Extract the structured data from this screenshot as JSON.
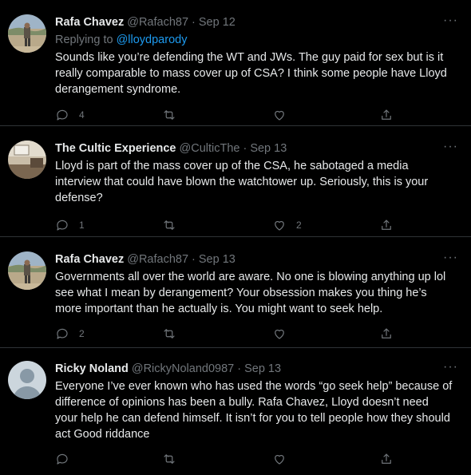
{
  "thread": {
    "tweets": [
      {
        "name": "Rafa Chavez",
        "handle": "@Rafach87",
        "separator": "·",
        "date": "Sep 12",
        "reply_label": "Replying to",
        "reply_mention": "@lloydparody",
        "text": "Sounds like you’re defending the WT and JWs. The guy paid for sex but is it really comparable to mass cover up of CSA? I think some people have Lloyd derangement syndrome.",
        "reply_count": "4",
        "retweet_count": "",
        "like_count": "",
        "more": "···",
        "avatar": "landscape-photo"
      },
      {
        "name": "The Cultic Experience",
        "handle": "@CulticThe",
        "separator": "·",
        "date": "Sep 13",
        "text": "Lloyd is part of the mass cover up of the CSA, he sabotaged a media interview that could have blown the watchtower up. Seriously, this is your defense?",
        "reply_count": "1",
        "retweet_count": "",
        "like_count": "2",
        "more": "···",
        "avatar": "room-photo"
      },
      {
        "name": "Rafa Chavez",
        "handle": "@Rafach87",
        "separator": "·",
        "date": "Sep 13",
        "text": "Governments all over the world are aware. No one is blowing anything up lol see what I mean by derangement? Your obsession makes you thing he’s more important than he actually is. You might want to seek help.",
        "reply_count": "2",
        "retweet_count": "",
        "like_count": "",
        "more": "···",
        "avatar": "landscape-photo"
      },
      {
        "name": "Ricky Noland",
        "handle": "@RickyNoland0987",
        "separator": "·",
        "date": "Sep 13",
        "text": "Everyone I’ve ever known who has used the words “go seek help” because of difference of opinions has been a bully. Rafa Chavez, Lloyd doesn’t need your help he can defend himself. It isn’t for you to tell people how they should act Good riddance",
        "reply_count": "",
        "retweet_count": "",
        "like_count": "",
        "more": "···",
        "avatar": "default-avatar"
      }
    ]
  },
  "colors": {
    "background": "#000000",
    "text": "#e7e9ea",
    "muted": "#71767b",
    "link": "#1d9bf0",
    "divider": "#2f3336"
  }
}
